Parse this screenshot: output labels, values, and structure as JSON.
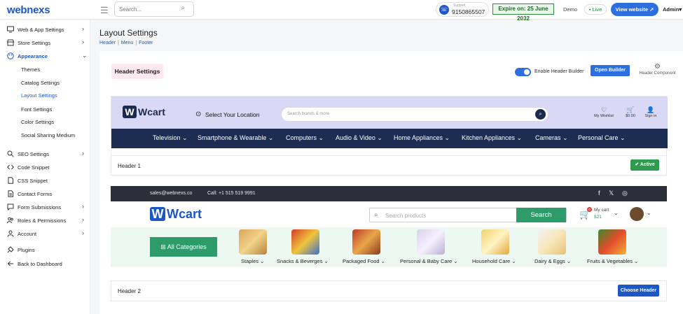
{
  "brand": "webnexs",
  "topbar": {
    "menu_icon": "hamburger-icon",
    "search_placeholder": "Search...",
    "support_label": "Support",
    "support_number": "9150865507",
    "expire": "Expire on: 25 June 2032",
    "demo": "Demo",
    "live": "• Live",
    "view_website": "View website ↗",
    "admin": "Admin▾",
    "colors": {
      "primary": "#2d6fe0",
      "expire_border": "#2f8a3a"
    }
  },
  "sidebar": {
    "items": [
      {
        "label": "Web & App Settings",
        "icon": "monitor-icon"
      },
      {
        "label": "Store Settings",
        "icon": "store-icon"
      },
      {
        "label": "Appearance",
        "icon": "palette-icon"
      },
      {
        "label": "Themes"
      },
      {
        "label": "Catalog Settings"
      },
      {
        "label": "Layout Settings"
      },
      {
        "label": "Font Settings"
      },
      {
        "label": "Color Settings"
      },
      {
        "label": "Social Sharing Medium"
      },
      {
        "label": "SEO Settings",
        "icon": "search-icon"
      },
      {
        "label": "Code Snippet",
        "icon": "code-icon"
      },
      {
        "label": "CSS Snippet",
        "icon": "file-icon"
      },
      {
        "label": "Contact Forms",
        "icon": "form-icon"
      },
      {
        "label": "Form Submissions",
        "icon": "chat-icon"
      },
      {
        "label": "Roles & Permissions",
        "icon": "users-icon"
      },
      {
        "label": "Account",
        "icon": "user-icon"
      },
      {
        "label": "Plugins",
        "icon": "plug-icon"
      },
      {
        "label": "Back to Dashboard",
        "icon": "arrow-left-icon"
      }
    ]
  },
  "page": {
    "title": "Layout Settings",
    "crumbs": [
      "Header",
      "Menu",
      "Footer"
    ],
    "separator": "|"
  },
  "header_settings": {
    "badge": "Header Settings",
    "enable_label": "Enable Header Builder",
    "open_builder": "Open Builder",
    "component_label": "Header Component"
  },
  "preview1": {
    "logo": "Wcart",
    "logo_letter": "W",
    "location": "Select Your Location",
    "search_placeholder": "Search brands & more",
    "icons": [
      {
        "label": "My Wishlist",
        "glyph": "♡"
      },
      {
        "label": "$0.00",
        "glyph": "🛒"
      },
      {
        "label": "Sign in",
        "glyph": "👤"
      }
    ],
    "nav": [
      "Television ⌄",
      "Smartphone & Wearable ⌄",
      "Computers ⌄",
      "Audio & Video ⌄",
      "Home Appliances ⌄",
      "Kitchen Appliances ⌄",
      "Cameras ⌄",
      "Personal Care ⌄"
    ]
  },
  "header1": {
    "title": "Header 1",
    "status": "✔ Active"
  },
  "preview2": {
    "email": "sales@webnexs.co",
    "call": "Call: +1 515 519 9991",
    "social": [
      "f",
      "𝕏",
      "◎"
    ],
    "logo": "Wcart",
    "logo_letter": "W",
    "search_placeholder": "Search products",
    "search_button": "Search",
    "cart_count": "0",
    "my_cart": "My cart",
    "cart_price": "$21",
    "all_categories": "All Categories",
    "categories": [
      "Staples ⌄",
      "Snacks & Beverges ⌄",
      "Packaged Food ⌄",
      "Personal & Baby Care ⌄",
      "Household Care ⌄",
      "Dairy & Eggs ⌄",
      "Fruits & Vegetables ⌄"
    ]
  },
  "header2": {
    "title": "Header 2",
    "action": "Choose Header"
  }
}
